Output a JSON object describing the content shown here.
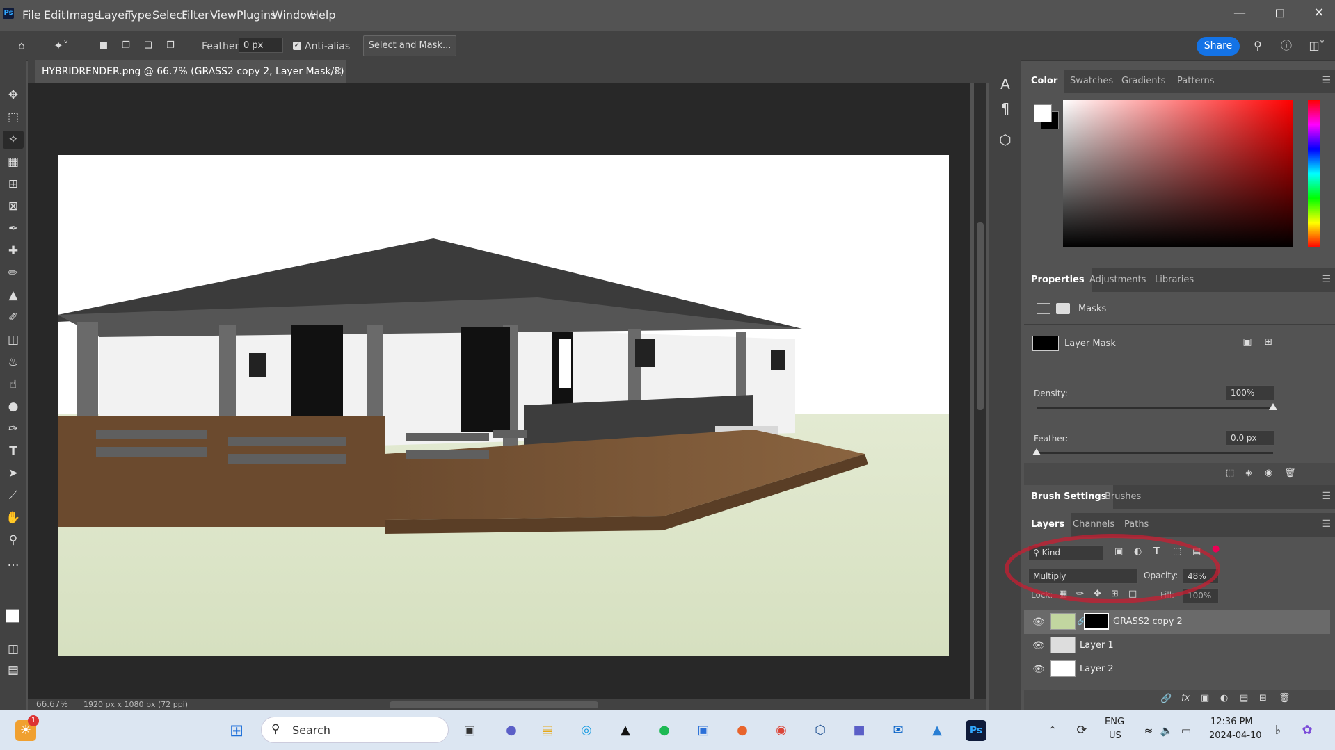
{
  "menubar": {
    "app_badge": "Ps",
    "items": [
      "File",
      "Edit",
      "Image",
      "Layer",
      "Type",
      "Select",
      "Filter",
      "View",
      "Plugins",
      "Window",
      "Help"
    ]
  },
  "options": {
    "feather_label": "Feather:",
    "feather_value": "0 px",
    "anti_alias_label": "Anti-alias",
    "anti_alias_checked": true,
    "select_and_mask_label": "Select and Mask...",
    "share_label": "Share"
  },
  "document": {
    "tab_title": "HYBRIDRENDER.png @ 66.7% (GRASS2 copy 2, Layer Mask/8) *",
    "zoom": "66.67%",
    "doc_info": "1920 px x 1080 px (72 ppi)"
  },
  "color_panel": {
    "tabs": [
      "Color",
      "Swatches",
      "Gradients",
      "Patterns"
    ],
    "active_tab": "Color",
    "foreground": "#ffffff",
    "background": "#000000",
    "hue_color": "#ff0000"
  },
  "properties_panel": {
    "tabs": [
      "Properties",
      "Adjustments",
      "Libraries"
    ],
    "active_tab": "Properties",
    "section_label": "Masks",
    "mask_label": "Layer Mask",
    "density_label": "Density:",
    "density_value": "100%",
    "density_fraction": 1.0,
    "feather_label": "Feather:",
    "feather_value": "0.0 px",
    "feather_fraction": 0.0
  },
  "brush_panel": {
    "tabs": [
      "Brush Settings",
      "Brushes"
    ],
    "active_tab": "Brush Settings"
  },
  "layers_panel": {
    "tabs": [
      "Layers",
      "Channels",
      "Paths"
    ],
    "active_tab": "Layers",
    "filter_kind": "Kind",
    "blend_mode": "Multiply",
    "opacity_label": "Opacity:",
    "opacity_value": "48%",
    "lock_label": "Lock:",
    "fill_label": "Fill:",
    "fill_value": "100%",
    "layers": [
      {
        "name": "GRASS2 copy 2",
        "selected": true,
        "visible": true,
        "has_mask": true
      },
      {
        "name": "Layer 1",
        "selected": false,
        "visible": true,
        "has_mask": false
      },
      {
        "name": "Layer 2",
        "selected": false,
        "visible": true,
        "has_mask": false
      }
    ]
  },
  "taskbar": {
    "search_label": "Search",
    "notification_count": "1",
    "lang_line1": "ENG",
    "lang_line2": "US",
    "time": "12:36 PM",
    "date": "2024-04-10"
  }
}
